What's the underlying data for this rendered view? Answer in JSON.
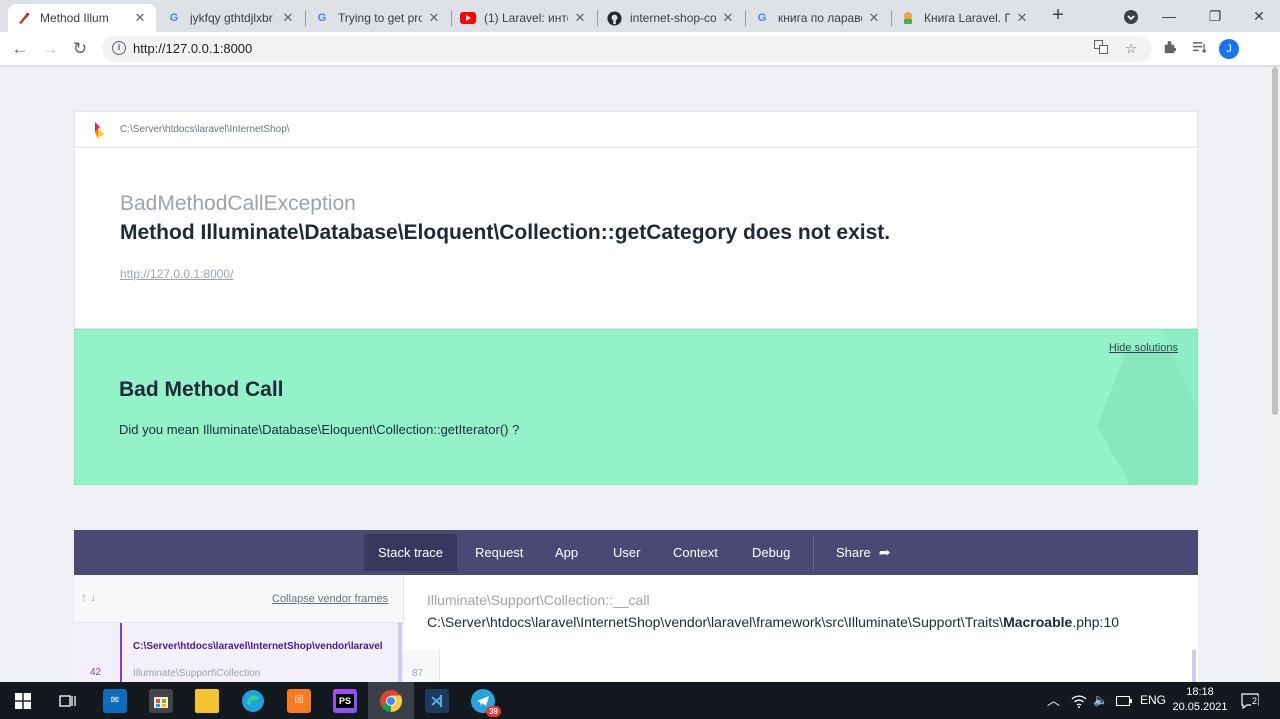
{
  "browser": {
    "tabs": [
      {
        "title": "Method Illum",
        "favicon": "laravel-icon",
        "active": true
      },
      {
        "title": "jykfqy gthtdjlxbr",
        "favicon": "google-icon",
        "active": false
      },
      {
        "title": "Trying to get prop",
        "favicon": "google-icon",
        "active": false
      },
      {
        "title": "(1) Laravel: интер",
        "favicon": "youtube-icon",
        "active": false
      },
      {
        "title": "internet-shop-co",
        "favicon": "github-icon",
        "active": false
      },
      {
        "title": "книга по ларавел",
        "favicon": "google-icon",
        "active": false
      },
      {
        "title": "Книга Laravel. По",
        "favicon": "book-icon",
        "active": false
      }
    ],
    "new_tab": "+",
    "address": "http://127.0.0.1:8000",
    "profile_initial": "J"
  },
  "error": {
    "project_path": "C:\\Server\\htdocs\\laravel\\InternetShop\\",
    "exception_class": "BadMethodCallException",
    "message": "Method Illuminate\\Database\\Eloquent\\Collection::getCategory does not exist.",
    "url": "http://127.0.0.1:8000/"
  },
  "solution": {
    "hide_label": "Hide solutions",
    "title": "Bad Method Call",
    "description": "Did you mean Illuminate\\Database\\Eloquent\\Collection::getIterator() ?"
  },
  "stack": {
    "tabs": [
      "Stack trace",
      "Request",
      "App",
      "User",
      "Context",
      "Debug",
      "Share"
    ],
    "arrows": "↑ ↓",
    "collapse_vendor": "Collapse vendor frames",
    "frame": {
      "number": "42",
      "file": "C:\\Server\\htdocs\\laravel\\InternetShop\\vendor\\laravel",
      "class": "Illuminate\\Support\\Collection"
    },
    "call_name": "Illuminate\\Support\\Collection::__call",
    "call_file_path": "C:\\Server\\htdocs\\laravel\\InternetShop\\vendor\\laravel\\framework\\src\\Illuminate\\Support\\Traits\\",
    "call_file_name": "Macroable",
    "call_file_ext": ".php:10",
    "code_line": "87"
  },
  "taskbar": {
    "language": "ENG",
    "time": "18:18",
    "date": "20.05.2021",
    "telegram_badge": "39",
    "notifications_count": "2"
  }
}
